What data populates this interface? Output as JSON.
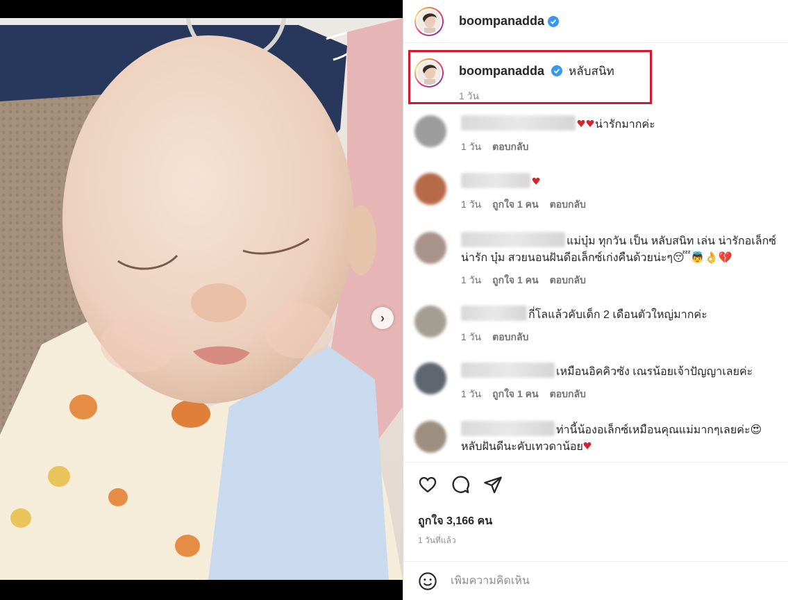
{
  "header": {
    "username": "boompanadda"
  },
  "caption": {
    "username": "boompanadda",
    "text": "หลับสนิท",
    "time": "1 วัน"
  },
  "comments": [
    {
      "text": "น่ารักมากค่ะ",
      "time": "1 วัน",
      "likes": "",
      "reply": "ตอบกลับ"
    },
    {
      "text": "",
      "time": "1 วัน",
      "likes": "ถูกใจ 1 คน",
      "reply": "ตอบกลับ"
    },
    {
      "text": "แม่บุ๋ม ทุกวัน เป็น หลับสนิท เล่น น่ารักอเล็กซ์น่ารัก บุ๋ม สวยนอนฝันดีอเล็กซ์เก่งคืนด้วยน่ะๆ😴👼👌💔",
      "time": "1 วัน",
      "likes": "ถูกใจ 1 คน",
      "reply": "ตอบกลับ"
    },
    {
      "text": "กี่โลแล้วคับเด็ก 2 เดือนตัวใหญ่มากค่ะ",
      "time": "1 วัน",
      "likes": "",
      "reply": "ตอบกลับ"
    },
    {
      "text": "เหมือนอิคคิวซัง เณรน้อยเจ้าปัญญาเลยค่ะ",
      "time": "1 วัน",
      "likes": "ถูกใจ 1 คน",
      "reply": "ตอบกลับ"
    },
    {
      "text": "ท่านี้น้องอเล็กซ์เหมือนคุณแม่มากๆเลยค่ะ😍 หลับฝันดีนะคับเทวดาน้อย",
      "time": "",
      "likes": "",
      "reply": ""
    }
  ],
  "likes": "ถูกใจ 3,166 คน",
  "posted": "1 วันที่แล้ว",
  "add_comment": {
    "placeholder": "เพิ่มความคิดเห็น"
  },
  "carousel": {
    "next": "›"
  },
  "icons": [
    "heart-icon",
    "comment-icon",
    "share-icon",
    "verified-icon",
    "emoji-icon",
    "chevron-right-icon"
  ],
  "colors": {
    "verified": "#3897f0",
    "highlight_box": "#d3182f",
    "meta": "#8e8e8e"
  }
}
